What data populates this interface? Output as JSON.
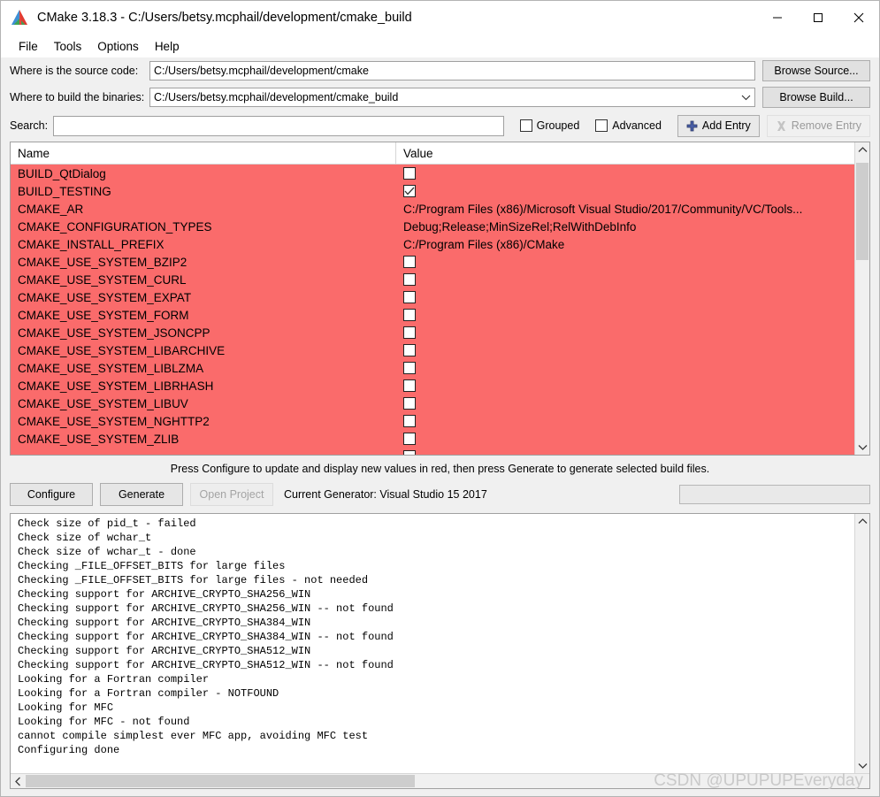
{
  "window": {
    "title": "CMake 3.18.3 - C:/Users/betsy.mcphail/development/cmake_build",
    "logo_icon": "cmake-logo-icon",
    "minimize_icon": "minimize-icon",
    "maximize_icon": "maximize-icon",
    "close_icon": "close-icon"
  },
  "menubar": {
    "items": [
      {
        "label": "File"
      },
      {
        "label": "Tools"
      },
      {
        "label": "Options"
      },
      {
        "label": "Help"
      }
    ]
  },
  "paths": {
    "source": {
      "label": "Where is the source code:",
      "value": "C:/Users/betsy.mcphail/development/cmake",
      "browse_label": "Browse Source..."
    },
    "build": {
      "label": "Where to build the binaries:",
      "value": "C:/Users/betsy.mcphail/development/cmake_build",
      "browse_label": "Browse Build...",
      "dropdown_icon": "chevron-down-icon"
    }
  },
  "toolbar": {
    "search_label": "Search:",
    "search_value": "",
    "search_placeholder": "",
    "grouped_label": "Grouped",
    "grouped_checked": false,
    "advanced_label": "Advanced",
    "advanced_checked": false,
    "add_entry_label": "Add Entry",
    "add_entry_icon": "plus-icon",
    "remove_entry_label": "Remove Entry",
    "remove_entry_icon": "remove-x-icon",
    "remove_entry_disabled": true
  },
  "cache_table": {
    "columns": [
      "Name",
      "Value"
    ],
    "row_highlight_color": "#fa6b6b",
    "rows": [
      {
        "name": "BUILD_QtDialog",
        "type": "checkbox",
        "checked": false,
        "value": ""
      },
      {
        "name": "BUILD_TESTING",
        "type": "checkbox",
        "checked": true,
        "value": ""
      },
      {
        "name": "CMAKE_AR",
        "type": "text",
        "value": "C:/Program Files (x86)/Microsoft Visual Studio/2017/Community/VC/Tools..."
      },
      {
        "name": "CMAKE_CONFIGURATION_TYPES",
        "type": "text",
        "value": "Debug;Release;MinSizeRel;RelWithDebInfo"
      },
      {
        "name": "CMAKE_INSTALL_PREFIX",
        "type": "text",
        "value": "C:/Program Files (x86)/CMake"
      },
      {
        "name": "CMAKE_USE_SYSTEM_BZIP2",
        "type": "checkbox",
        "checked": false,
        "value": ""
      },
      {
        "name": "CMAKE_USE_SYSTEM_CURL",
        "type": "checkbox",
        "checked": false,
        "value": ""
      },
      {
        "name": "CMAKE_USE_SYSTEM_EXPAT",
        "type": "checkbox",
        "checked": false,
        "value": ""
      },
      {
        "name": "CMAKE_USE_SYSTEM_FORM",
        "type": "checkbox",
        "checked": false,
        "value": ""
      },
      {
        "name": "CMAKE_USE_SYSTEM_JSONCPP",
        "type": "checkbox",
        "checked": false,
        "value": ""
      },
      {
        "name": "CMAKE_USE_SYSTEM_LIBARCHIVE",
        "type": "checkbox",
        "checked": false,
        "value": ""
      },
      {
        "name": "CMAKE_USE_SYSTEM_LIBLZMA",
        "type": "checkbox",
        "checked": false,
        "value": ""
      },
      {
        "name": "CMAKE_USE_SYSTEM_LIBRHASH",
        "type": "checkbox",
        "checked": false,
        "value": ""
      },
      {
        "name": "CMAKE_USE_SYSTEM_LIBUV",
        "type": "checkbox",
        "checked": false,
        "value": ""
      },
      {
        "name": "CMAKE_USE_SYSTEM_NGHTTP2",
        "type": "checkbox",
        "checked": false,
        "value": ""
      },
      {
        "name": "CMAKE_USE_SYSTEM_ZLIB",
        "type": "checkbox",
        "checked": false,
        "value": ""
      },
      {
        "name": "",
        "type": "checkbox",
        "checked": false,
        "value": ""
      }
    ],
    "scroll_up_icon": "chevron-up-icon",
    "scroll_down_icon": "chevron-down-icon"
  },
  "hint": "Press Configure to update and display new values in red, then press Generate to generate selected build files.",
  "actions": {
    "configure_label": "Configure",
    "generate_label": "Generate",
    "open_project_label": "Open Project",
    "open_project_disabled": true,
    "generator_text": "Current Generator: Visual Studio 15 2017",
    "progress_value": ""
  },
  "log": {
    "lines": [
      "Check size of pid_t - failed",
      "Check size of wchar_t",
      "Check size of wchar_t - done",
      "Checking _FILE_OFFSET_BITS for large files",
      "Checking _FILE_OFFSET_BITS for large files - not needed",
      "Checking support for ARCHIVE_CRYPTO_SHA256_WIN",
      "Checking support for ARCHIVE_CRYPTO_SHA256_WIN -- not found",
      "Checking support for ARCHIVE_CRYPTO_SHA384_WIN",
      "Checking support for ARCHIVE_CRYPTO_SHA384_WIN -- not found",
      "Checking support for ARCHIVE_CRYPTO_SHA512_WIN",
      "Checking support for ARCHIVE_CRYPTO_SHA512_WIN -- not found",
      "Looking for a Fortran compiler",
      "Looking for a Fortran compiler - NOTFOUND",
      "Looking for MFC",
      "Looking for MFC - not found",
      "cannot compile simplest ever MFC app, avoiding MFC test",
      "Configuring done"
    ],
    "scroll_left_icon": "chevron-left-icon",
    "scroll_up_icon": "chevron-up-icon",
    "scroll_down_icon": "chevron-down-icon"
  },
  "watermark": "CSDN @UPUPUPEveryday"
}
